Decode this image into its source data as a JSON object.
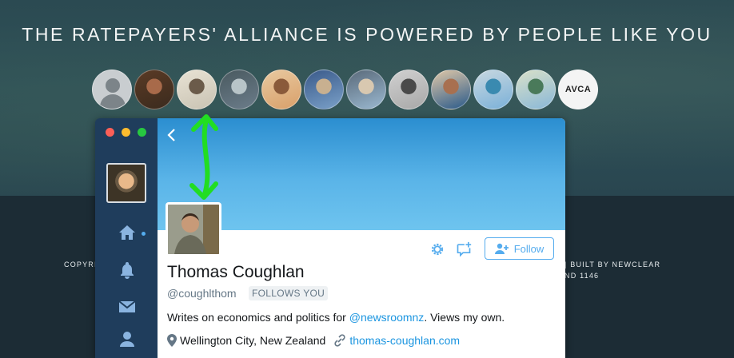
{
  "page": {
    "headline": "THE RATEPAYERS' ALLIANCE IS POWERED BY PEOPLE LIKE YOU",
    "supporter_avatars": [
      {
        "kind": "placeholder"
      },
      {
        "kind": "photo",
        "colors": [
          "#3b2b1e",
          "#a86a4a",
          "#5a3a25"
        ]
      },
      {
        "kind": "photo",
        "colors": [
          "#c9c3b3",
          "#6b5b4a",
          "#e8e2d4"
        ]
      },
      {
        "kind": "photo",
        "colors": [
          "#6b7c8a",
          "#b8c4c8",
          "#4a5a60"
        ]
      },
      {
        "kind": "photo",
        "colors": [
          "#d9a06a",
          "#8a5a3a",
          "#e8c9a0"
        ]
      },
      {
        "kind": "photo",
        "colors": [
          "#7aa0c8",
          "#c8b090",
          "#3a5a8a"
        ]
      },
      {
        "kind": "photo",
        "colors": [
          "#9ab8d0",
          "#d8c8b0",
          "#5a6a7a"
        ]
      },
      {
        "kind": "photo",
        "colors": [
          "#a8a8a8",
          "#4a4a4a",
          "#d0d0d0"
        ]
      },
      {
        "kind": "photo",
        "colors": [
          "#2a5a8a",
          "#a87050",
          "#e0c8a8"
        ]
      },
      {
        "kind": "photo",
        "colors": [
          "#7ab0d8",
          "#3a8ab0",
          "#c8d8e0"
        ]
      },
      {
        "kind": "photo",
        "colors": [
          "#8ab8d8",
          "#4a7a5a",
          "#d8e0c8"
        ]
      },
      {
        "kind": "logo",
        "label": "AVCA"
      }
    ],
    "footer_left": "COPYRI",
    "footer_right": "|  BUILT BY NEWCLEAR",
    "footer_right2": "ND 1146"
  },
  "twitter": {
    "back_icon": "chevron-left-icon",
    "nav_icons": [
      "home-icon",
      "notifications-icon",
      "messages-icon",
      "profile-icon"
    ],
    "follow_label": "Follow",
    "name": "Thomas Coughlan",
    "handle": "@coughlthom",
    "follows_you": "FOLLOWS YOU",
    "bio_prefix": "Writes on economics and politics for ",
    "bio_mention": "@newsroomnz",
    "bio_suffix": ". Views my own.",
    "location": "Wellington City, New Zealand",
    "website": "thomas-coughlan.com",
    "colors": {
      "accent": "#55acee",
      "sidebar": "#1f3d5c",
      "banner": "#5ab4e8"
    }
  },
  "annotation": {
    "arrow_color": "#22dd22"
  }
}
